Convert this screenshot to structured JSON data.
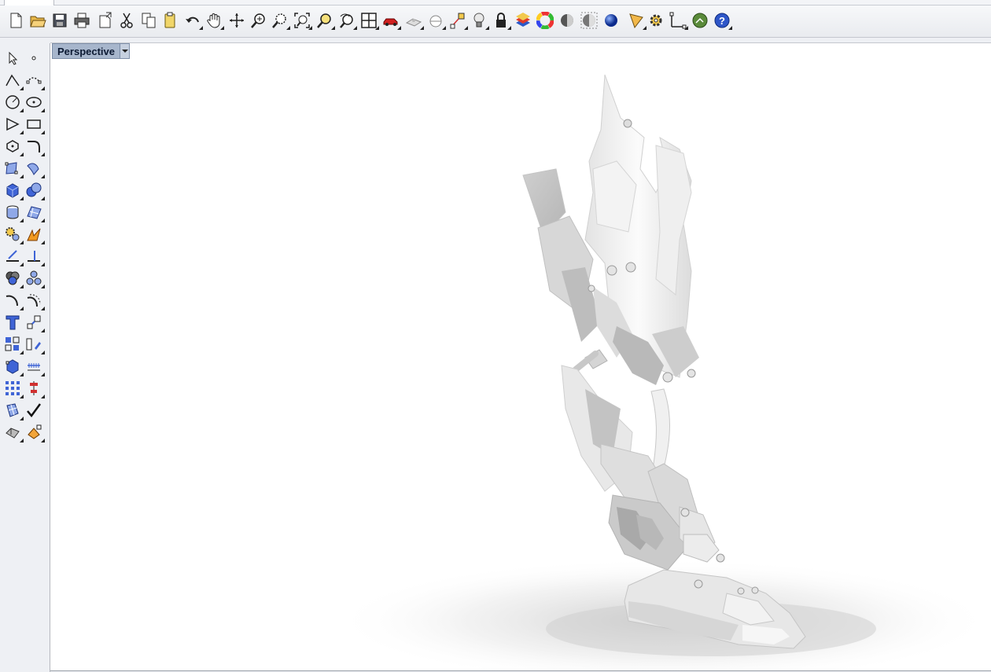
{
  "viewport": {
    "label": "Perspective"
  },
  "toolbar": {
    "buttons": [
      {
        "icon": "new-file-icon"
      },
      {
        "icon": "open-folder-icon"
      },
      {
        "icon": "save-icon"
      },
      {
        "icon": "print-icon"
      },
      {
        "icon": "import-icon"
      },
      {
        "icon": "cut-icon"
      },
      {
        "icon": "copy-icon"
      },
      {
        "icon": "paste-icon"
      },
      {
        "icon": "undo-icon"
      },
      {
        "icon": "pan-hand-icon"
      },
      {
        "icon": "rotate-view-icon"
      },
      {
        "icon": "zoom-dynamic-icon"
      },
      {
        "icon": "zoom-window-icon"
      },
      {
        "icon": "zoom-extents-icon"
      },
      {
        "icon": "zoom-selected-icon"
      },
      {
        "icon": "undo-view-icon"
      },
      {
        "icon": "four-viewports-icon"
      },
      {
        "icon": "named-view-car-icon"
      },
      {
        "icon": "construction-plane-icon"
      },
      {
        "icon": "set-cplane-icon"
      },
      {
        "icon": "object-snap-icon"
      },
      {
        "icon": "light-bulb-icon"
      },
      {
        "icon": "lock-icon"
      },
      {
        "icon": "layer-icon"
      },
      {
        "icon": "color-wheel-icon"
      },
      {
        "icon": "shaded-display-icon"
      },
      {
        "icon": "rendered-display-icon"
      },
      {
        "icon": "render-icon"
      },
      {
        "icon": "cone-options-icon"
      },
      {
        "icon": "options-gear-icon"
      },
      {
        "icon": "dimension-icon"
      },
      {
        "icon": "plugin-icon"
      },
      {
        "icon": "help-icon"
      }
    ]
  },
  "left_toolbar": {
    "buttons": [
      "select-arrow-icon",
      "point-icon",
      "polyline-icon",
      "curve-icon",
      "circle-icon",
      "ellipse-icon",
      "arc-icon",
      "rectangle-icon",
      "polygon-icon",
      "fillet-curve-icon",
      "surface-from-points-icon",
      "loft-surface-icon",
      "box-solid-icon",
      "sphere-solid-icon",
      "cylinder-solid-icon",
      "network-surface-icon",
      "solid-tools-icon",
      "explode-icon",
      "trim-icon",
      "split-icon",
      "boolean-union-icon",
      "boolean-split-icon",
      "curve-from-object-icon",
      "offset-curve-icon",
      "text-icon",
      "scale-icon",
      "array-icon",
      "flow-icon",
      "cage-edit-icon",
      "dimension-linear-icon",
      "grid-array-icon",
      "align-icon",
      "mesh-icon",
      "check-mark-icon",
      "analyze-icon",
      "render-material-icon"
    ]
  }
}
